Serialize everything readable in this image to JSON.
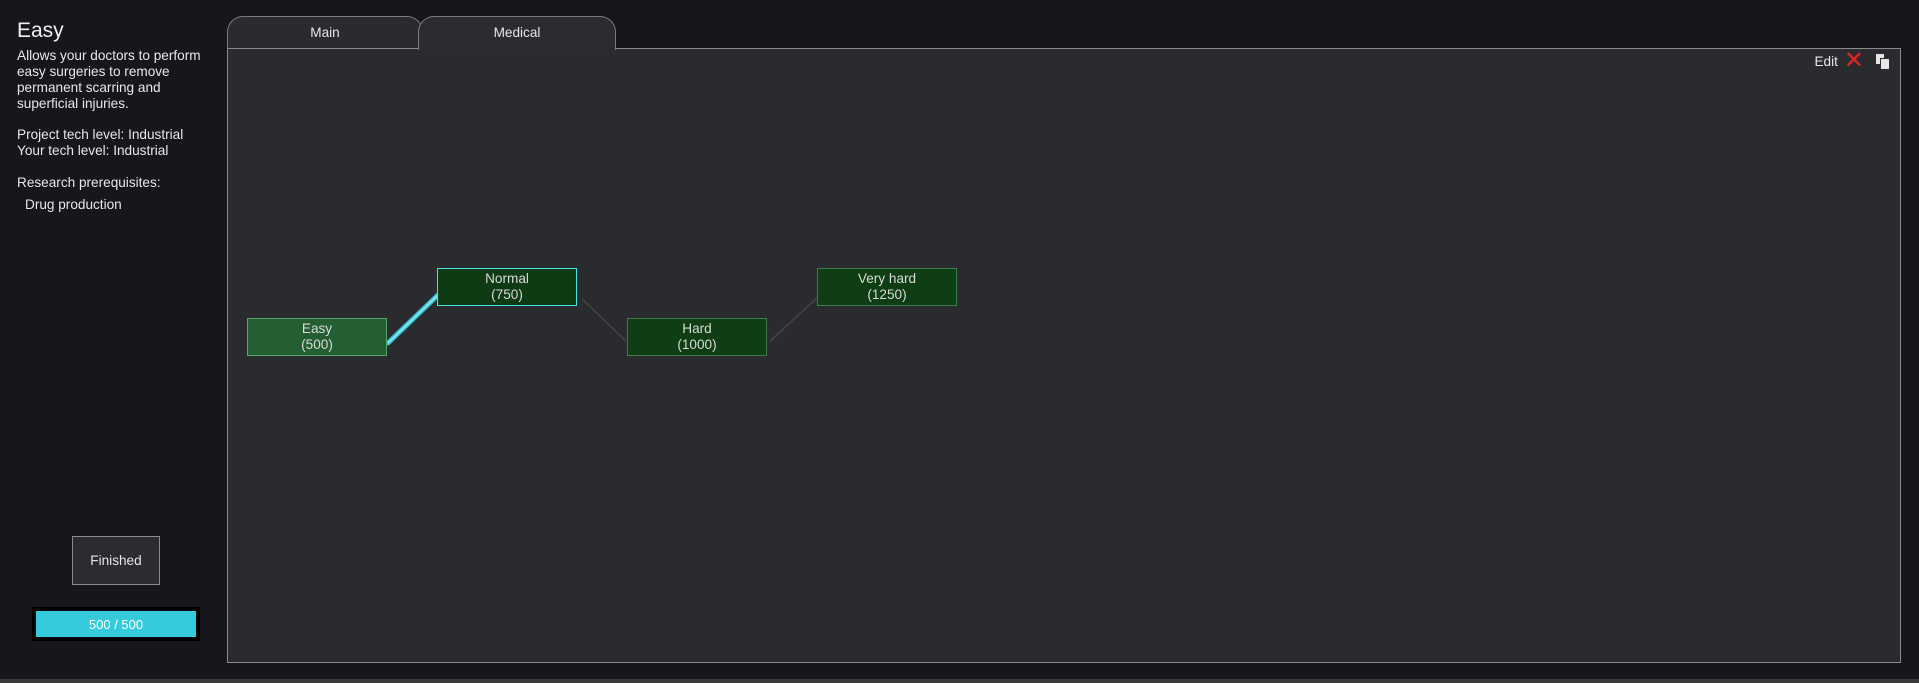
{
  "project": {
    "title": "Easy",
    "description": "Allows your doctors to perform easy surgeries to remove permanent scarring and superficial injuries.",
    "tech_level_line": "Project tech level: Industrial",
    "your_tech_line": "Your tech level: Industrial",
    "prereq_label": "Research prerequisites:",
    "prereq_item": "Drug production"
  },
  "actions": {
    "finished_label": "Finished",
    "progress_text": "500 / 500",
    "progress_fraction": 1.0
  },
  "tabs": [
    {
      "label": "Main",
      "active": false
    },
    {
      "label": "Medical",
      "active": true
    }
  ],
  "panel": {
    "edit_label": "Edit",
    "close_icon": "close-icon",
    "copy_icon": "copy-icon"
  },
  "nodes": [
    {
      "name": "Easy",
      "cost": "(500)",
      "state": "finished"
    },
    {
      "name": "Normal",
      "cost": "(750)",
      "state": "selected"
    },
    {
      "name": "Hard",
      "cost": "(1000)",
      "state": "available"
    },
    {
      "name": "Very hard",
      "cost": "(1250)",
      "state": "available"
    }
  ],
  "colors": {
    "progress": "#35cbdb",
    "node_finished": "#245e33",
    "node_available": "#0f3d14",
    "selected_border": "#4ce0e6",
    "close": "#e02424"
  }
}
